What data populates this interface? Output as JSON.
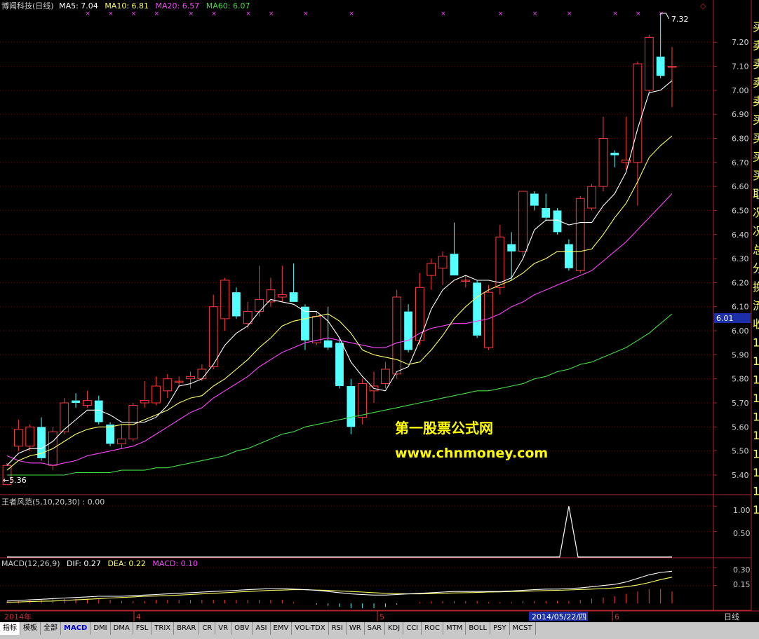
{
  "header": {
    "stock": "博闻科技(日线)",
    "ma5_label": "MA5: 7.04",
    "ma10_label": "MA10: 6.81",
    "ma20_label": "MA20: 6.57",
    "ma60_label": "MA60: 6.07",
    "ma5_color": "#ffffff",
    "ma10_color": "#ffff66",
    "ma20_color": "#ff44ff",
    "ma60_color": "#44dd44"
  },
  "annotations": {
    "high": "7.32",
    "low": "←5.36",
    "price_tag": "6.01",
    "watermark_cn": "第一股票公式网",
    "watermark_url": "www.chnmoney.com"
  },
  "right_labels": [
    "买",
    "卖",
    "卖",
    "卖",
    "卖",
    "买",
    "买",
    "买",
    "买",
    "取",
    "况",
    "况",
    "总",
    "分",
    "换",
    "流",
    "收",
    "1",
    "1",
    "1",
    "1",
    "1",
    "1",
    "1",
    "1",
    "1",
    "1"
  ],
  "panel2": {
    "label": "王者风范(5,10,20,30) : 0.00",
    "ticks": [
      "1.00",
      "0.50"
    ]
  },
  "panel3": {
    "label_main": "MACD(12,26,9)",
    "label_dif": "DIF: 0.27",
    "label_dea": "DEA: 0.22",
    "label_macd": "MACD: 0.10",
    "ticks": [
      "0.30",
      "0.15"
    ]
  },
  "timeaxis": {
    "labels": [
      "2014年",
      "4",
      "5",
      "6"
    ],
    "cursor": "2014/05/22/四",
    "period": "日线"
  },
  "toolbar": {
    "tabs": [
      "指标",
      "模板",
      "全部",
      "MACD",
      "DMI",
      "DMA",
      "FSL",
      "TRIX",
      "BRAR",
      "CR",
      "VR",
      "OBV",
      "ASI",
      "EMV",
      "VOL-TDX",
      "RSI",
      "WR",
      "SAR",
      "KDJ",
      "CCI",
      "ROC",
      "MTM",
      "BOLL",
      "PSY",
      "MCST"
    ]
  },
  "chart_data": {
    "type": "candlestick",
    "ylim": [
      5.33,
      7.32
    ],
    "yticks": [
      5.4,
      5.5,
      5.6,
      5.7,
      5.8,
      5.9,
      6.0,
      6.1,
      6.2,
      6.3,
      6.4,
      6.5,
      6.6,
      6.7,
      6.8,
      6.9,
      7.0,
      7.1,
      7.2
    ],
    "colors": {
      "up": "#ff3b3b",
      "down": "#54ffff"
    },
    "candles": [
      {
        "o": 5.36,
        "h": 5.45,
        "l": 5.36,
        "c": 5.44
      },
      {
        "o": 5.52,
        "h": 5.63,
        "l": 5.5,
        "c": 5.59
      },
      {
        "o": 5.52,
        "h": 5.61,
        "l": 5.5,
        "c": 5.6
      },
      {
        "o": 5.6,
        "h": 5.64,
        "l": 5.46,
        "c": 5.47
      },
      {
        "o": 5.44,
        "h": 5.6,
        "l": 5.42,
        "c": 5.58
      },
      {
        "o": 5.58,
        "h": 5.72,
        "l": 5.57,
        "c": 5.7
      },
      {
        "o": 5.71,
        "h": 5.74,
        "l": 5.68,
        "c": 5.7
      },
      {
        "o": 5.69,
        "h": 5.75,
        "l": 5.68,
        "c": 5.71
      },
      {
        "o": 5.71,
        "h": 5.73,
        "l": 5.61,
        "c": 5.62
      },
      {
        "o": 5.61,
        "h": 5.62,
        "l": 5.52,
        "c": 5.53
      },
      {
        "o": 5.53,
        "h": 5.61,
        "l": 5.51,
        "c": 5.55
      },
      {
        "o": 5.55,
        "h": 5.7,
        "l": 5.54,
        "c": 5.69
      },
      {
        "o": 5.7,
        "h": 5.79,
        "l": 5.68,
        "c": 5.71
      },
      {
        "o": 5.7,
        "h": 5.81,
        "l": 5.69,
        "c": 5.77
      },
      {
        "o": 5.75,
        "h": 5.82,
        "l": 5.72,
        "c": 5.8
      },
      {
        "o": 5.79,
        "h": 5.81,
        "l": 5.77,
        "c": 5.79
      },
      {
        "o": 5.8,
        "h": 5.83,
        "l": 5.76,
        "c": 5.81
      },
      {
        "o": 5.8,
        "h": 5.86,
        "l": 5.79,
        "c": 5.84
      },
      {
        "o": 5.85,
        "h": 6.15,
        "l": 5.84,
        "c": 6.1
      },
      {
        "o": 6.05,
        "h": 6.22,
        "l": 6.0,
        "c": 6.21
      },
      {
        "o": 6.16,
        "h": 6.18,
        "l": 6.05,
        "c": 6.06
      },
      {
        "o": 6.03,
        "h": 6.12,
        "l": 6.01,
        "c": 6.08
      },
      {
        "o": 6.08,
        "h": 6.27,
        "l": 6.06,
        "c": 6.13
      },
      {
        "o": 6.12,
        "h": 6.22,
        "l": 6.1,
        "c": 6.17
      },
      {
        "o": 6.14,
        "h": 6.27,
        "l": 6.12,
        "c": 6.15
      },
      {
        "o": 6.16,
        "h": 6.28,
        "l": 6.12,
        "c": 6.12
      },
      {
        "o": 6.1,
        "h": 6.11,
        "l": 5.92,
        "c": 5.96
      },
      {
        "o": 5.95,
        "h": 6.08,
        "l": 5.94,
        "c": 6.06
      },
      {
        "o": 5.96,
        "h": 6.1,
        "l": 5.92,
        "c": 5.93
      },
      {
        "o": 5.95,
        "h": 5.97,
        "l": 5.76,
        "c": 5.77
      },
      {
        "o": 5.77,
        "h": 5.8,
        "l": 5.57,
        "c": 5.6
      },
      {
        "o": 5.64,
        "h": 5.8,
        "l": 5.61,
        "c": 5.78
      },
      {
        "o": 5.75,
        "h": 5.83,
        "l": 5.7,
        "c": 5.77
      },
      {
        "o": 5.78,
        "h": 5.87,
        "l": 5.76,
        "c": 5.84
      },
      {
        "o": 5.82,
        "h": 6.17,
        "l": 5.8,
        "c": 6.14
      },
      {
        "o": 6.08,
        "h": 6.11,
        "l": 5.91,
        "c": 5.92
      },
      {
        "o": 5.96,
        "h": 6.24,
        "l": 5.94,
        "c": 6.18
      },
      {
        "o": 6.23,
        "h": 6.3,
        "l": 6.17,
        "c": 6.28
      },
      {
        "o": 6.26,
        "h": 6.33,
        "l": 6.19,
        "c": 6.31
      },
      {
        "o": 6.32,
        "h": 6.45,
        "l": 6.24,
        "c": 6.23
      },
      {
        "o": 6.21,
        "h": 6.23,
        "l": 6.18,
        "c": 6.21
      },
      {
        "o": 6.2,
        "h": 6.21,
        "l": 5.97,
        "c": 5.98
      },
      {
        "o": 5.93,
        "h": 6.19,
        "l": 5.92,
        "c": 6.16
      },
      {
        "o": 6.18,
        "h": 6.44,
        "l": 6.15,
        "c": 6.39
      },
      {
        "o": 6.36,
        "h": 6.41,
        "l": 6.21,
        "c": 6.33
      },
      {
        "o": 6.33,
        "h": 6.58,
        "l": 6.31,
        "c": 6.58
      },
      {
        "o": 6.57,
        "h": 6.58,
        "l": 6.5,
        "c": 6.52
      },
      {
        "o": 6.51,
        "h": 6.57,
        "l": 6.46,
        "c": 6.47
      },
      {
        "o": 6.5,
        "h": 6.51,
        "l": 6.4,
        "c": 6.41
      },
      {
        "o": 6.36,
        "h": 6.38,
        "l": 6.25,
        "c": 6.26
      },
      {
        "o": 6.25,
        "h": 6.56,
        "l": 6.24,
        "c": 6.55
      },
      {
        "o": 6.51,
        "h": 6.61,
        "l": 6.5,
        "c": 6.6
      },
      {
        "o": 6.6,
        "h": 6.89,
        "l": 6.58,
        "c": 6.8
      },
      {
        "o": 6.74,
        "h": 6.75,
        "l": 6.68,
        "c": 6.73
      },
      {
        "o": 6.7,
        "h": 6.89,
        "l": 6.67,
        "c": 6.71
      },
      {
        "o": 6.7,
        "h": 7.12,
        "l": 6.52,
        "c": 7.11
      },
      {
        "o": 7.0,
        "h": 7.23,
        "l": 6.98,
        "c": 7.22
      },
      {
        "o": 7.14,
        "h": 7.32,
        "l": 7.05,
        "c": 7.06
      },
      {
        "o": 7.1,
        "h": 7.18,
        "l": 6.93,
        "c": 7.1
      }
    ],
    "ma5": [
      5.44,
      5.49,
      5.51,
      5.51,
      5.54,
      5.59,
      5.63,
      5.67,
      5.67,
      5.65,
      5.62,
      5.62,
      5.62,
      5.64,
      5.69,
      5.77,
      5.78,
      5.8,
      5.86,
      5.94,
      5.99,
      6.02,
      6.08,
      6.13,
      6.12,
      6.11,
      6.08,
      6.08,
      6.04,
      5.97,
      5.87,
      5.81,
      5.76,
      5.75,
      5.83,
      5.85,
      5.96,
      6.09,
      6.17,
      6.21,
      6.23,
      6.21,
      6.21,
      6.2,
      6.22,
      6.3,
      6.42,
      6.46,
      6.46,
      6.44,
      6.45,
      6.45,
      6.52,
      6.57,
      6.66,
      6.84,
      6.99,
      7.0,
      7.04
    ],
    "ma10": [
      5.42,
      5.46,
      5.48,
      5.49,
      5.51,
      5.54,
      5.57,
      5.59,
      5.6,
      5.6,
      5.61,
      5.61,
      5.63,
      5.65,
      5.67,
      5.7,
      5.72,
      5.73,
      5.77,
      5.8,
      5.84,
      5.88,
      5.93,
      5.97,
      6.02,
      6.04,
      6.05,
      6.06,
      6.07,
      6.04,
      5.99,
      5.92,
      5.9,
      5.89,
      5.88,
      5.86,
      5.87,
      5.92,
      5.98,
      6.05,
      6.1,
      6.14,
      6.17,
      6.19,
      6.21,
      6.24,
      6.28,
      6.3,
      6.33,
      6.33,
      6.33,
      6.34,
      6.4,
      6.47,
      6.53,
      6.62,
      6.72,
      6.77,
      6.81
    ],
    "ma20": [
      5.48,
      5.46,
      5.45,
      5.45,
      5.44,
      5.45,
      5.46,
      5.48,
      5.49,
      5.5,
      5.51,
      5.52,
      5.54,
      5.57,
      5.6,
      5.63,
      5.66,
      5.68,
      5.72,
      5.75,
      5.78,
      5.81,
      5.85,
      5.88,
      5.91,
      5.93,
      5.95,
      5.96,
      5.97,
      5.96,
      5.95,
      5.94,
      5.93,
      5.93,
      5.95,
      5.96,
      5.99,
      6.01,
      6.02,
      6.03,
      6.03,
      6.04,
      6.05,
      6.07,
      6.1,
      6.12,
      6.15,
      6.17,
      6.19,
      6.21,
      6.23,
      6.25,
      6.29,
      6.33,
      6.37,
      6.42,
      6.47,
      6.52,
      6.57
    ],
    "ma60": [
      5.4,
      5.4,
      5.4,
      5.4,
      5.4,
      5.4,
      5.41,
      5.41,
      5.41,
      5.41,
      5.42,
      5.42,
      5.42,
      5.43,
      5.43,
      5.44,
      5.45,
      5.46,
      5.47,
      5.48,
      5.5,
      5.51,
      5.53,
      5.55,
      5.57,
      5.58,
      5.6,
      5.61,
      5.62,
      5.63,
      5.64,
      5.65,
      5.66,
      5.67,
      5.68,
      5.69,
      5.7,
      5.71,
      5.72,
      5.73,
      5.74,
      5.75,
      5.75,
      5.76,
      5.77,
      5.78,
      5.8,
      5.81,
      5.83,
      5.84,
      5.86,
      5.87,
      5.89,
      5.91,
      5.93,
      5.96,
      5.99,
      6.03,
      6.07
    ],
    "signal": [
      0,
      0,
      0,
      0,
      0,
      0,
      0,
      0,
      0,
      0,
      0,
      0,
      0,
      0,
      0,
      0,
      0,
      0,
      0,
      0,
      0,
      0,
      0,
      0,
      0,
      0,
      0,
      0,
      0,
      0,
      0,
      0,
      0,
      0,
      0,
      0,
      0,
      0,
      0,
      0,
      0,
      0,
      0,
      0,
      0,
      0,
      0,
      0,
      0,
      1,
      0,
      0,
      0,
      0,
      0,
      0,
      0,
      0,
      0
    ],
    "signal_ylim": [
      0,
      1.1
    ],
    "macd_ylim": [
      -0.04,
      0.36
    ],
    "dif": [
      0.02,
      0.025,
      0.03,
      0.035,
      0.04,
      0.045,
      0.05,
      0.055,
      0.06,
      0.06,
      0.06,
      0.065,
      0.07,
      0.075,
      0.08,
      0.085,
      0.09,
      0.095,
      0.1,
      0.105,
      0.11,
      0.115,
      0.12,
      0.125,
      0.125,
      0.12,
      0.115,
      0.11,
      0.1,
      0.09,
      0.08,
      0.075,
      0.07,
      0.07,
      0.075,
      0.08,
      0.085,
      0.09,
      0.095,
      0.1,
      0.1,
      0.1,
      0.1,
      0.1,
      0.105,
      0.11,
      0.115,
      0.12,
      0.12,
      0.125,
      0.13,
      0.14,
      0.15,
      0.16,
      0.18,
      0.21,
      0.24,
      0.26,
      0.27
    ],
    "dea": [
      0.01,
      0.012,
      0.015,
      0.018,
      0.02,
      0.025,
      0.03,
      0.035,
      0.04,
      0.045,
      0.05,
      0.055,
      0.06,
      0.062,
      0.065,
      0.07,
      0.075,
      0.08,
      0.085,
      0.09,
      0.095,
      0.1,
      0.105,
      0.11,
      0.112,
      0.115,
      0.115,
      0.112,
      0.11,
      0.105,
      0.1,
      0.095,
      0.09,
      0.085,
      0.082,
      0.08,
      0.08,
      0.082,
      0.085,
      0.088,
      0.09,
      0.092,
      0.095,
      0.097,
      0.1,
      0.102,
      0.105,
      0.108,
      0.11,
      0.113,
      0.117,
      0.12,
      0.125,
      0.13,
      0.14,
      0.155,
      0.175,
      0.2,
      0.22
    ],
    "macd": [
      0.02,
      0.02,
      0.03,
      0.03,
      0.04,
      0.04,
      0.04,
      0.04,
      0.04,
      0.03,
      0.02,
      0.02,
      0.02,
      0.03,
      0.03,
      0.03,
      0.03,
      0.03,
      0.03,
      0.03,
      0.03,
      0.03,
      0.03,
      0.03,
      0.03,
      0.01,
      0.0,
      -0.01,
      -0.02,
      -0.03,
      -0.04,
      -0.04,
      -0.04,
      -0.03,
      -0.01,
      0.0,
      0.01,
      0.02,
      0.02,
      0.02,
      0.02,
      0.02,
      0.01,
      0.01,
      0.01,
      0.02,
      0.02,
      0.02,
      0.02,
      0.02,
      0.03,
      0.04,
      0.05,
      0.06,
      0.08,
      0.1,
      0.12,
      0.12,
      0.1
    ],
    "buy_marks": [
      7,
      9,
      11,
      13,
      16,
      18,
      21,
      23,
      26,
      30,
      38,
      43,
      46,
      49,
      53,
      55,
      57
    ]
  }
}
